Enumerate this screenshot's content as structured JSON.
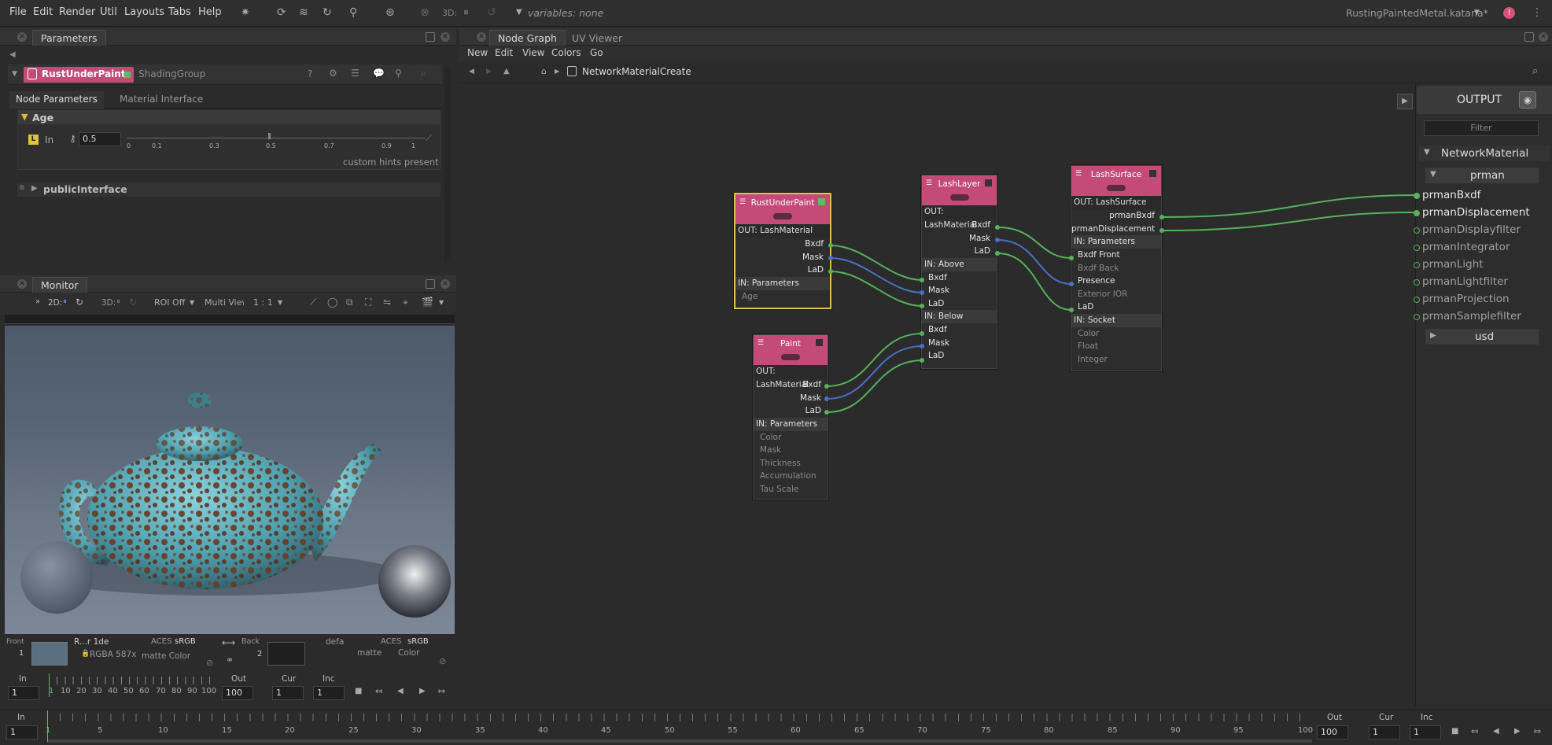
{
  "menubar": {
    "items": [
      "File",
      "Edit",
      "Render",
      "Util",
      "Layouts",
      "Tabs",
      "Help"
    ],
    "threeD": "3D:",
    "variables": "variables: none",
    "project": "RustingPaintedMetal.katana*"
  },
  "params": {
    "tab": "Parameters",
    "node_name": "RustUnderPaint",
    "node_type": "ShadingGroup",
    "subtabs": [
      "Node Parameters",
      "Material Interface"
    ],
    "group": "Age",
    "field_label": "In",
    "field_value": "0.5",
    "slider_ticks": [
      "0",
      "0.1",
      "0.3",
      "0.5",
      "0.7",
      "0.9",
      "1"
    ],
    "hint": "custom hints present",
    "group2": "publicInterface"
  },
  "monitor": {
    "tab": "Monitor",
    "twoD": "2D:",
    "threeD": "3D:",
    "roi": "ROI Off",
    "view": "Multi View",
    "ratio": "1 : 1",
    "front": "Front",
    "front_num": "1",
    "name": "R...r  1de",
    "cs1": "ACES",
    "srgb1": "sRGB",
    "rgba": "RGBA 587x",
    "matte_color": "matte Color",
    "back": "Back",
    "back_num": "2",
    "defa": "defa",
    "cs2": "ACES",
    "srgb2": "sRGB",
    "matte": "matte",
    "color": "Color"
  },
  "mini_timeline": {
    "in_label": "In",
    "in_value": "1",
    "ticks": [
      "1",
      "10",
      "20",
      "30",
      "40",
      "50",
      "60",
      "70",
      "80",
      "90",
      "100"
    ],
    "out_label": "Out",
    "out_value": "100",
    "cur_label": "Cur",
    "cur_value": "1",
    "inc_label": "Inc",
    "inc_value": "1"
  },
  "nodegraph": {
    "tabs": [
      "Node Graph",
      "UV Viewer"
    ],
    "menu": [
      "New",
      "Edit",
      "View",
      "Colors",
      "Go"
    ],
    "breadcrumb": "NetworkMaterialCreate"
  },
  "nodes": {
    "rust": {
      "title": "RustUnderPaint",
      "out": "OUT: LashMaterial",
      "outputs": [
        "Bxdf",
        "Mask",
        "LaD"
      ],
      "in": "IN: Parameters",
      "inputs": [
        "Age"
      ]
    },
    "paint": {
      "title": "Paint",
      "out": "OUT: LashMaterial",
      "outputs": [
        "Bxdf",
        "Mask",
        "LaD"
      ],
      "in": "IN: Parameters",
      "inputs": [
        "Color",
        "Mask",
        "Thickness",
        "Accumulation",
        "Tau Scale"
      ]
    },
    "layer": {
      "title": "LashLayer",
      "out": "OUT: LashMaterial",
      "outputs": [
        "Bxdf",
        "Mask",
        "LaD"
      ],
      "in_above": "IN: Above",
      "above": [
        "Bxdf",
        "Mask",
        "LaD"
      ],
      "in_below": "IN: Below",
      "below": [
        "Bxdf",
        "Mask",
        "LaD"
      ]
    },
    "surface": {
      "title": "LashSurface",
      "out": "OUT: LashSurface",
      "outputs": [
        "prmanBxdf",
        "prmanDisplacement"
      ],
      "in": "IN: Parameters",
      "inputs": [
        "Bxdf Front",
        "Bxdf Back",
        "Presence",
        "Exterior IOR",
        "LaD"
      ],
      "in_socket": "IN: Socket",
      "socket": [
        "Color",
        "Float",
        "Integer"
      ]
    }
  },
  "output": {
    "title": "OUTPUT",
    "filter": "Filter",
    "network": "NetworkMaterial",
    "prman": "prman",
    "ports": [
      "prmanBxdf",
      "prmanDisplacement",
      "prmanDisplayfilter",
      "prmanIntegrator",
      "prmanLight",
      "prmanLightfilter",
      "prmanProjection",
      "prmanSamplefilter"
    ],
    "usd": "usd"
  },
  "timeline": {
    "in_label": "In",
    "in_value": "1",
    "ticks": [
      "1",
      "5",
      "10",
      "15",
      "20",
      "25",
      "30",
      "35",
      "40",
      "45",
      "50",
      "55",
      "60",
      "65",
      "70",
      "75",
      "80",
      "85",
      "90",
      "95",
      "100"
    ],
    "out_label": "Out",
    "out_value": "100",
    "cur_label": "Cur",
    "cur_value": "1",
    "inc_label": "Inc",
    "inc_value": "1"
  },
  "colors": {
    "node_header": "#c44b78",
    "wire_green": "#55b25a",
    "wire_blue": "#4b6fc4",
    "selected": "#e3c54a"
  }
}
